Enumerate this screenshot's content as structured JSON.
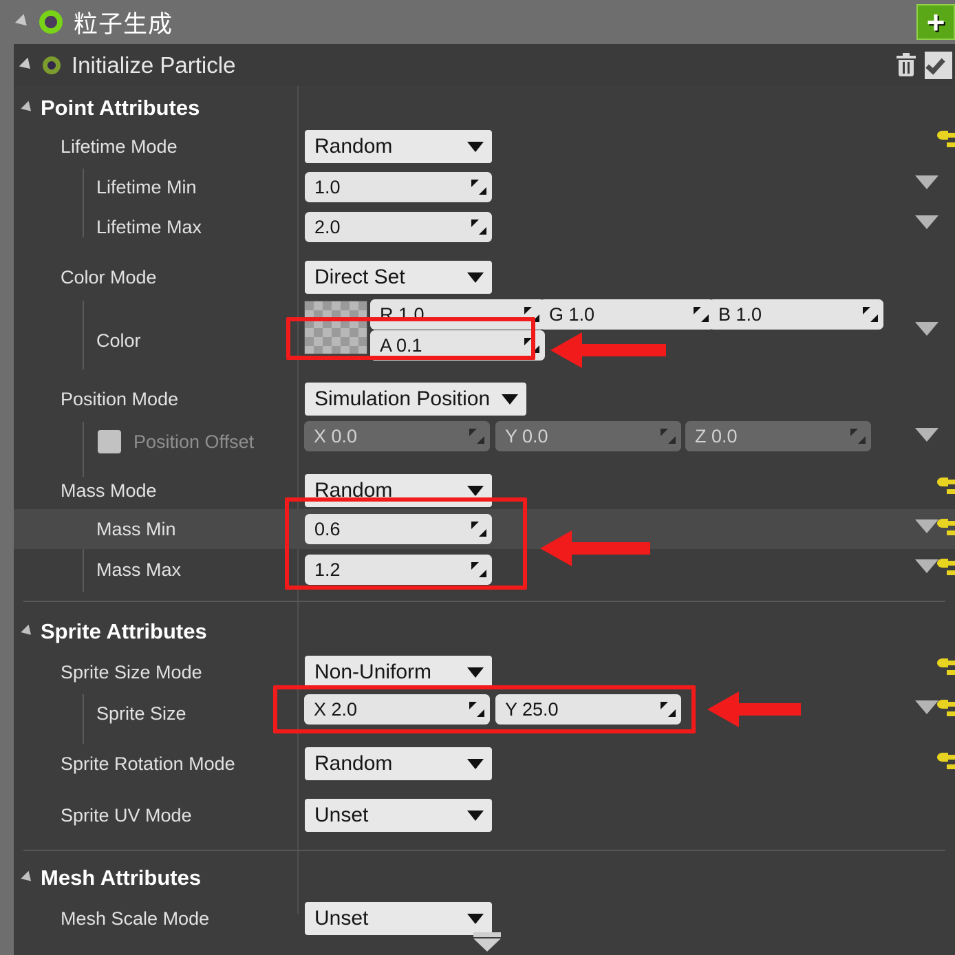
{
  "emitter": {
    "title": "粒子生成",
    "collapse_icon": "triangle-collapse-icon",
    "status_icon": "emitter-enabled-dot-icon",
    "add_button_label": "+"
  },
  "module": {
    "title": "Initialize Particle",
    "collapse_icon": "triangle-collapse-icon",
    "status_icon": "module-enabled-dot-icon",
    "delete_icon": "trash-icon",
    "enabled_icon": "checkmark-icon"
  },
  "sections": [
    {
      "key": "point",
      "title": "Point Attributes"
    },
    {
      "key": "sprite",
      "title": "Sprite Attributes"
    },
    {
      "key": "mesh",
      "title": "Mesh Attributes"
    }
  ],
  "point_attributes": {
    "lifetime_mode": {
      "label": "Lifetime Mode",
      "value": "Random"
    },
    "lifetime_min": {
      "label": "Lifetime Min",
      "value": "1.0"
    },
    "lifetime_max": {
      "label": "Lifetime Max",
      "value": "2.0"
    },
    "color_mode": {
      "label": "Color Mode",
      "value": "Direct Set"
    },
    "color": {
      "label": "Color",
      "r": "R 1.0",
      "g": "G 1.0",
      "b": "B 1.0",
      "a": "A 0.1"
    },
    "position_mode": {
      "label": "Position Mode",
      "value": "Simulation Position"
    },
    "position_offset": {
      "label": "Position Offset",
      "enabled": false,
      "x": "X 0.0",
      "y": "Y 0.0",
      "z": "Z 0.0"
    },
    "mass_mode": {
      "label": "Mass Mode",
      "value": "Random"
    },
    "mass_min": {
      "label": "Mass Min",
      "value": "0.6"
    },
    "mass_max": {
      "label": "Mass Max",
      "value": "1.2"
    }
  },
  "sprite_attributes": {
    "sprite_size_mode": {
      "label": "Sprite Size Mode",
      "value": "Non-Uniform"
    },
    "sprite_size": {
      "label": "Sprite Size",
      "x": "X 2.0",
      "y": "Y 25.0"
    },
    "sprite_rotation_mode": {
      "label": "Sprite Rotation Mode",
      "value": "Random"
    },
    "sprite_uv_mode": {
      "label": "Sprite UV Mode",
      "value": "Unset"
    }
  },
  "mesh_attributes": {
    "mesh_scale_mode": {
      "label": "Mesh Scale Mode",
      "value": "Unset"
    }
  },
  "annotations": {
    "color_alpha_highlight": "red-box-color-alpha",
    "mass_highlight": "red-box-mass-min-max",
    "sprite_size_highlight": "red-box-sprite-size",
    "arrow_icon": "red-arrow-icon"
  },
  "colors": {
    "accent_green": "#78d318",
    "annotation_red": "#f21b1b",
    "pin_yellow": "#e8d320",
    "panel_bg": "#3d3d3d",
    "field_bg": "#e4e4e4"
  },
  "scroll": {
    "down_indicator": "scroll-down-icon"
  }
}
